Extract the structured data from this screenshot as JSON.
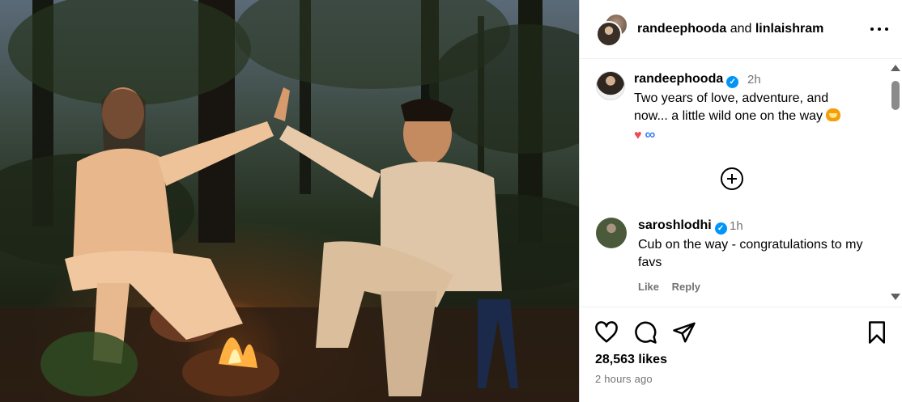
{
  "post": {
    "header": {
      "author": "randeephooda",
      "connector": "and",
      "coauthor": "linlaishram"
    },
    "caption": {
      "username": "randeephooda",
      "verified": true,
      "time": "2h",
      "text": "Two years of love, adventure, and now... a little wild one on the way",
      "emojis": [
        "tiger-face",
        "red-heart",
        "infinity"
      ]
    },
    "comments": [
      {
        "username": "saroshlodhi",
        "verified": true,
        "time": "1h",
        "text": "Cub on the way - congratulations to my favs",
        "like_label": "Like",
        "reply_label": "Reply"
      }
    ],
    "likes": "28,563 likes",
    "posted": "2 hours ago"
  },
  "icons": {
    "more": "more-options-icon",
    "load_more": "plus-circle-icon",
    "like": "heart-icon",
    "comment": "comment-icon",
    "share": "share-icon",
    "save": "bookmark-icon"
  },
  "colors": {
    "verified": "#0095f6",
    "muted_text": "#737373",
    "heart_emoji": "#ed4956"
  }
}
